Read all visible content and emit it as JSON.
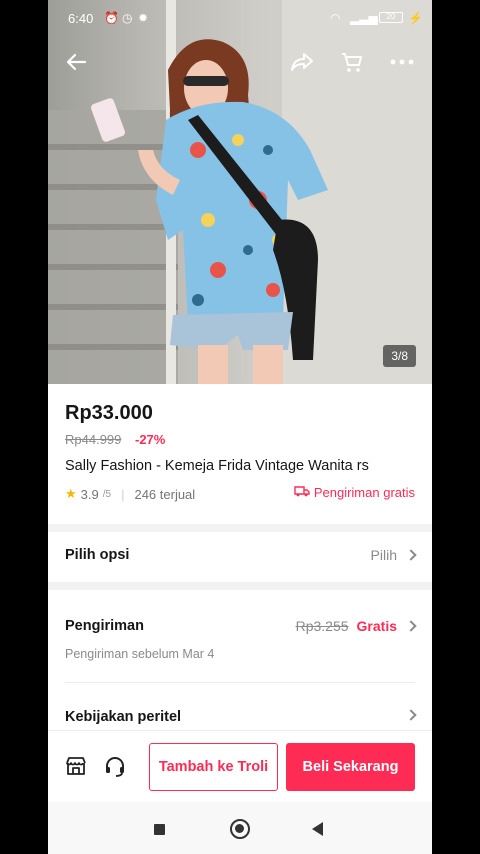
{
  "status_bar": {
    "time": "6:40",
    "battery": "20",
    "colors": {
      "text": "#ffffff"
    }
  },
  "gallery": {
    "counter": "3/8"
  },
  "product": {
    "price": "Rp33.000",
    "original_price": "Rp44.999",
    "discount": "-27%",
    "title": "Sally Fashion - Kemeja Frida Vintage Wanita rs",
    "rating": "3.9",
    "rating_max": "/5",
    "sold": "246 terjual",
    "shipping_badge": "Pengiriman gratis"
  },
  "options_row": {
    "label": "Pilih opsi",
    "value": "Pilih"
  },
  "shipping_row": {
    "label": "Pengiriman",
    "old_cost": "Rp3.255",
    "cost": "Gratis",
    "subtext": "Pengiriman sebelum Mar 4"
  },
  "policy_row": {
    "label": "Kebijakan peritel"
  },
  "bottom_bar": {
    "add_to_cart": "Tambah ke Troli",
    "buy_now": "Beli Sekarang"
  },
  "icons": [
    "back-arrow-icon",
    "share-icon",
    "cart-icon",
    "more-icon",
    "store-icon",
    "headset-icon",
    "star-icon",
    "truck-icon",
    "chevron-right-icon"
  ],
  "colors": {
    "accent": "#fe2c55",
    "star": "#f7b500",
    "text": "#161616",
    "muted": "#8a8a8a"
  }
}
